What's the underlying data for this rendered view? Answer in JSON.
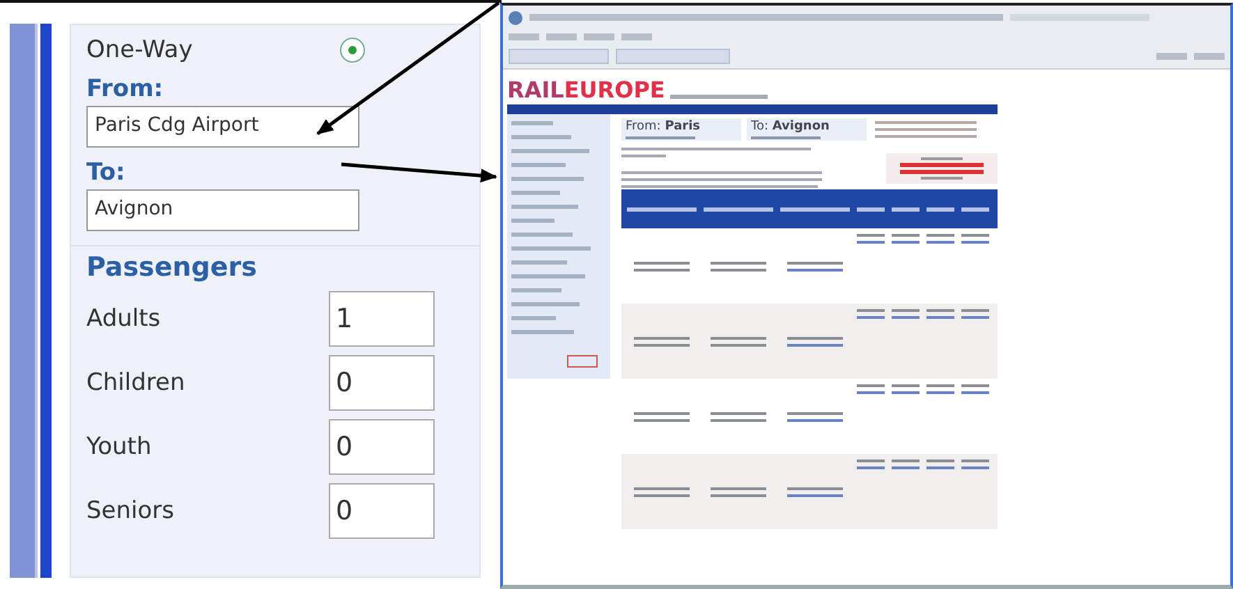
{
  "panel": {
    "trip_type": {
      "label": "One-Way",
      "selected": true
    },
    "from": {
      "label": "From:",
      "value": "Paris Cdg Airport"
    },
    "to": {
      "label": "To:",
      "value": "Avignon"
    },
    "passengers": {
      "heading": "Passengers",
      "rows": [
        {
          "label": "Adults",
          "value": "1"
        },
        {
          "label": "Children",
          "value": "0"
        },
        {
          "label": "Youth",
          "value": "0"
        },
        {
          "label": "Seniors",
          "value": "0"
        }
      ]
    }
  },
  "screenshot": {
    "logo_left": "RAIL",
    "logo_right": "EUROPE",
    "from_label": "From:",
    "from_city": "Paris",
    "to_label": "To:",
    "to_city": "Avignon"
  }
}
